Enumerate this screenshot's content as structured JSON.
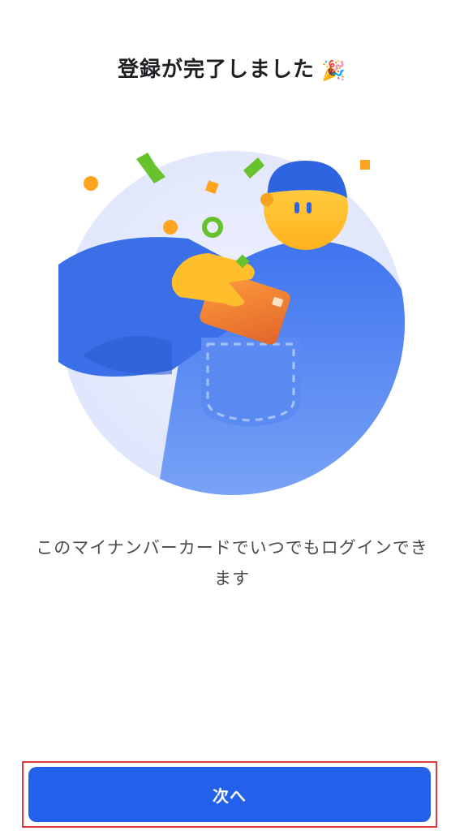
{
  "page": {
    "title": "登録が完了しました",
    "title_emoji": "🎉",
    "message": "このマイナンバーカードでいつでもログインできます",
    "next_button_label": "次へ"
  },
  "colors": {
    "primary": "#2361ea",
    "text_dark": "#1e1f22",
    "text_body": "#4a4b50",
    "highlight_border": "#e23b3b"
  },
  "illustration": {
    "icon": "completion-illustration"
  }
}
